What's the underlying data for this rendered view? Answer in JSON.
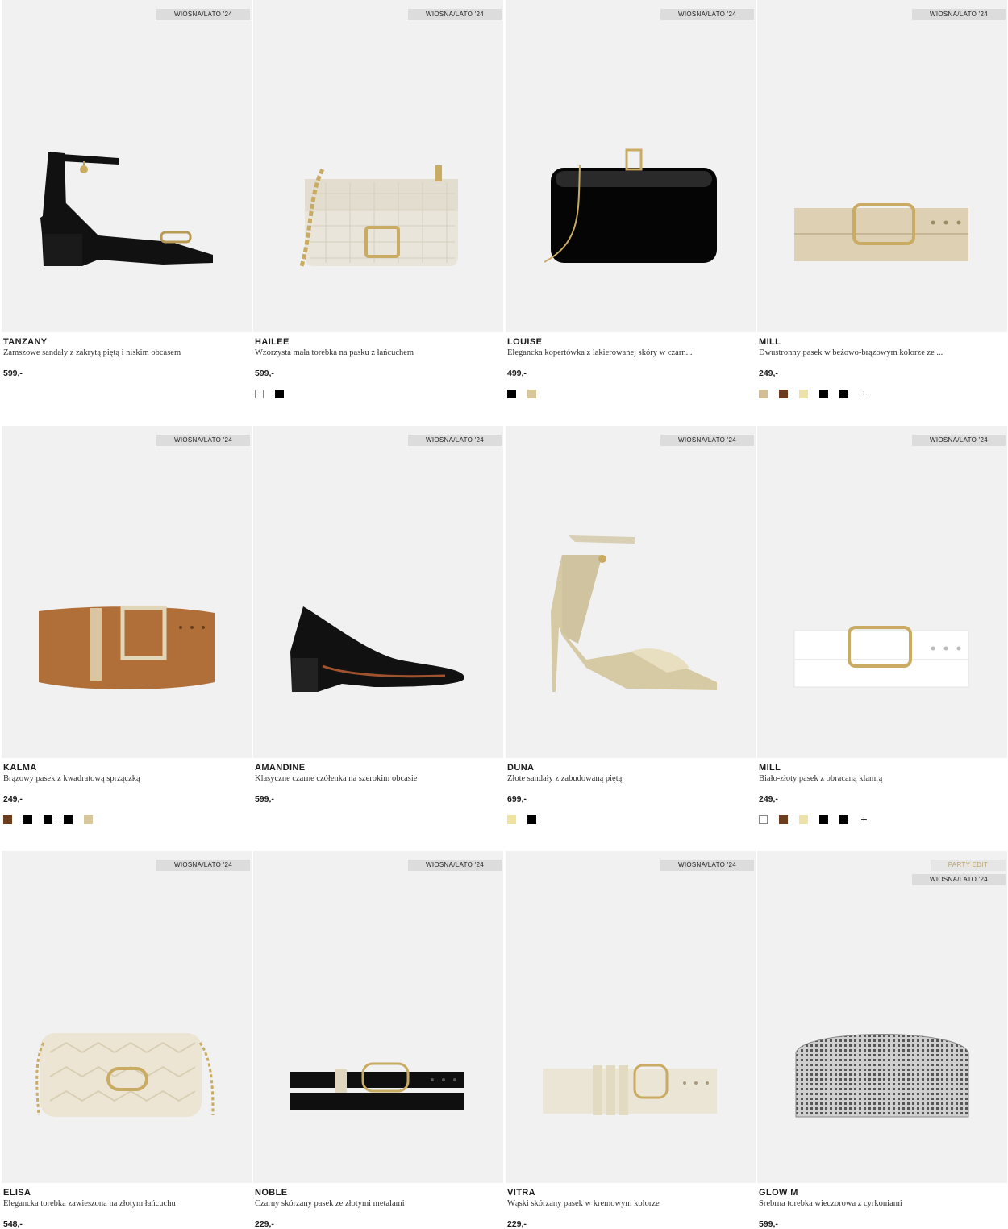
{
  "products": [
    {
      "name": "TANZANY",
      "desc": "Zamszowe sandały z zakrytą piętą i niskim obcasem",
      "price": "599,-",
      "badges": [
        "WIOSNA/LATO '24"
      ],
      "icon": "sandal-black-icon",
      "swatches": [],
      "plus": ""
    },
    {
      "name": "HAILEE",
      "desc": "Wzorzysta mała torebka na pasku z łańcuchem",
      "price": "599,-",
      "badges": [
        "WIOSNA/LATO '24"
      ],
      "icon": "bag-cream-icon",
      "swatches": [
        "#ffffff",
        "#000000"
      ],
      "plus": ""
    },
    {
      "name": "LOUISE",
      "desc": "Elegancka kopertówka z lakierowanej skóry w czarn...",
      "price": "499,-",
      "badges": [
        "WIOSNA/LATO '24"
      ],
      "icon": "clutch-black-icon",
      "swatches": [
        "#000000",
        "#d8c79a"
      ],
      "plus": ""
    },
    {
      "name": "MILL",
      "desc": "Dwustronny pasek w beżowo-brązowym kolorze ze ...",
      "price": "249,-",
      "badges": [
        "WIOSNA/LATO '24"
      ],
      "icon": "belt-beige-icon",
      "swatches": [
        "#d4bf95",
        "#6b3d1c",
        "#ede2a8",
        "#000000",
        "#000000"
      ],
      "plus": "+"
    },
    {
      "name": "KALMA",
      "desc": "Brązowy pasek z kwadratową sprzączką",
      "price": "249,-",
      "badges": [
        "WIOSNA/LATO '24"
      ],
      "icon": "belt-brown-icon",
      "swatches": [
        "#6b3d1c",
        "#000000",
        "#000000",
        "#000000",
        "#d8c79a"
      ],
      "plus": ""
    },
    {
      "name": "AMANDINE",
      "desc": "Klasyczne czarne czółenka na szerokim obcasie",
      "price": "599,-",
      "badges": [
        "WIOSNA/LATO '24"
      ],
      "icon": "pump-black-icon",
      "swatches": [],
      "plus": ""
    },
    {
      "name": "DUNA",
      "desc": "Złote sandały z zabudowaną piętą",
      "price": "699,-",
      "badges": [
        "WIOSNA/LATO '24"
      ],
      "icon": "sandal-gold-icon",
      "swatches": [
        "#f0e3a0",
        "#000000"
      ],
      "plus": ""
    },
    {
      "name": "MILL",
      "desc": "Biało-złoty pasek z obracaną klamrą",
      "price": "249,-",
      "badges": [
        "WIOSNA/LATO '24"
      ],
      "icon": "belt-white-icon",
      "swatches": [
        "#ffffff",
        "#6b3d1c",
        "#ede2a8",
        "#000000",
        "#000000"
      ],
      "plus": "+"
    },
    {
      "name": "ELISA",
      "desc": "Elegancka torebka zawieszona na złotym łańcuchu",
      "price": "548,-",
      "badges": [
        "WIOSNA/LATO '24"
      ],
      "icon": "bag-quilted-icon",
      "swatches": [],
      "plus": ""
    },
    {
      "name": "NOBLE",
      "desc": "Czarny skórzany pasek ze złotymi metalami",
      "price": "229,-",
      "badges": [
        "WIOSNA/LATO '24"
      ],
      "icon": "belt-black-icon",
      "swatches": [],
      "plus": ""
    },
    {
      "name": "VITRA",
      "desc": "Wąski skórzany pasek w kremowym kolorze",
      "price": "229,-",
      "badges": [
        "WIOSNA/LATO '24"
      ],
      "icon": "belt-cream-icon",
      "swatches": [],
      "plus": ""
    },
    {
      "name": "GLOW M",
      "desc": "Srebrna torebka wieczorowa z cyrkoniami",
      "price": "599,-",
      "badges": [
        "PARTY EDIT",
        "WIOSNA/LATO '24"
      ],
      "icon": "bag-sparkle-icon",
      "swatches": [],
      "plus": ""
    }
  ]
}
